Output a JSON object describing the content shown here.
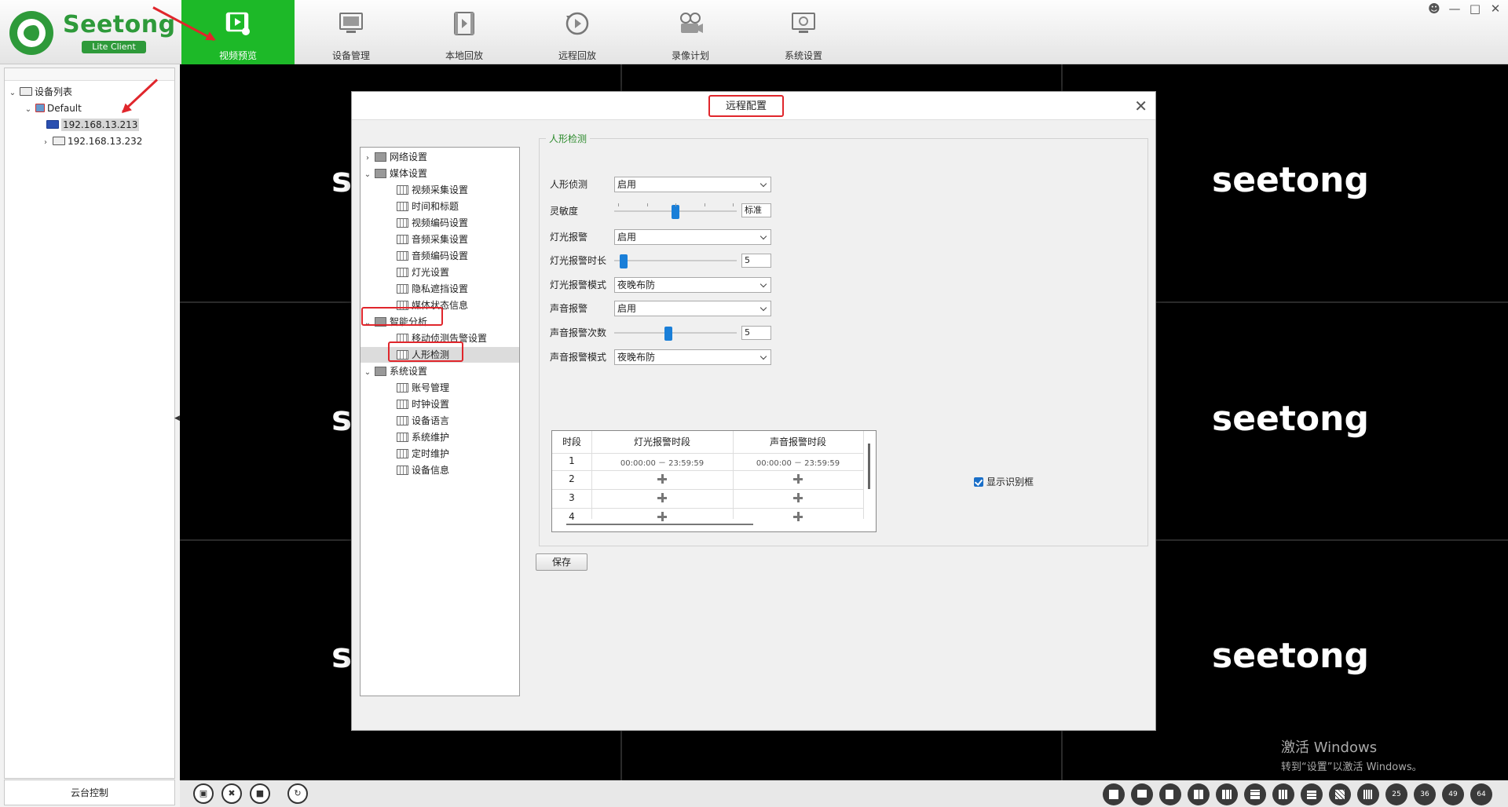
{
  "app": {
    "logo_name": "Seetong",
    "logo_sub": "Lite Client"
  },
  "nav": [
    {
      "label": "视频预览",
      "icon": "video-preview-icon",
      "active": true
    },
    {
      "label": "设备管理",
      "icon": "device-manage-icon",
      "active": false
    },
    {
      "label": "本地回放",
      "icon": "local-playback-icon",
      "active": false
    },
    {
      "label": "远程回放",
      "icon": "remote-playback-icon",
      "active": false
    },
    {
      "label": "录像计划",
      "icon": "record-plan-icon",
      "active": false
    },
    {
      "label": "系统设置",
      "icon": "system-settings-icon",
      "active": false
    }
  ],
  "sidebar": {
    "root": "设备列表",
    "group": "Default",
    "devices": [
      "192.168.13.213",
      "192.168.13.232"
    ],
    "ptz_tab": "云台控制"
  },
  "video": {
    "watermark": "seetong",
    "watermark_partial": "s"
  },
  "activation": {
    "line1": "激活 Windows",
    "line2": "转到“设置”以激活 Windows。"
  },
  "bottom": {
    "layout_labels": [
      "25",
      "36",
      "49",
      "64"
    ]
  },
  "dialog": {
    "title": "远程配置",
    "tree": [
      {
        "label": "网络设置",
        "level": 0,
        "expand": "›"
      },
      {
        "label": "媒体设置",
        "level": 0,
        "expand": "⌄"
      },
      {
        "label": "视频采集设置",
        "level": 1
      },
      {
        "label": "时间和标题",
        "level": 1
      },
      {
        "label": "视频编码设置",
        "level": 1
      },
      {
        "label": "音频采集设置",
        "level": 1
      },
      {
        "label": "音频编码设置",
        "level": 1
      },
      {
        "label": "灯光设置",
        "level": 1
      },
      {
        "label": "隐私遮挡设置",
        "level": 1
      },
      {
        "label": "媒体状态信息",
        "level": 1
      },
      {
        "label": "智能分析",
        "level": 0,
        "expand": "⌄"
      },
      {
        "label": "移动侦测告警设置",
        "level": 1
      },
      {
        "label": "人形检测",
        "level": 1,
        "selected": true
      },
      {
        "label": "系统设置",
        "level": 0,
        "expand": "⌄"
      },
      {
        "label": "账号管理",
        "level": 1
      },
      {
        "label": "时钟设置",
        "level": 1
      },
      {
        "label": "设备语言",
        "level": 1
      },
      {
        "label": "系统维护",
        "level": 1
      },
      {
        "label": "定时维护",
        "level": 1
      },
      {
        "label": "设备信息",
        "level": 1
      }
    ],
    "group_title": "人形检测",
    "fields": {
      "human_detect_label": "人形侦测",
      "human_detect_value": "启用",
      "sensitivity_label": "灵敏度",
      "sensitivity_value": "标准",
      "sensitivity_level": 0.5,
      "light_alarm_label": "灯光报警",
      "light_alarm_value": "启用",
      "light_duration_label": "灯光报警时长",
      "light_duration_value": "5",
      "light_duration_level": 0.05,
      "light_mode_label": "灯光报警模式",
      "light_mode_value": "夜晚布防",
      "sound_alarm_label": "声音报警",
      "sound_alarm_value": "启用",
      "sound_count_label": "声音报警次数",
      "sound_count_value": "5",
      "sound_count_level": 0.44,
      "sound_mode_label": "声音报警模式",
      "sound_mode_value": "夜晚布防"
    },
    "schedule": {
      "headers": [
        "时段",
        "灯光报警时段",
        "声音报警时段"
      ],
      "rows": [
        {
          "index": "1",
          "light": "00:00:00 － 23:59:59",
          "sound": "00:00:00 － 23:59:59"
        },
        {
          "index": "2",
          "light": "",
          "sound": ""
        },
        {
          "index": "3",
          "light": "",
          "sound": ""
        },
        {
          "index": "4",
          "light": "",
          "sound": ""
        }
      ]
    },
    "show_box_label": "显示识别框",
    "save_label": "保存"
  },
  "colors": {
    "brand_green": "#2e9a3a",
    "nav_active": "#1db928",
    "highlight_red": "#e0262c",
    "slider_blue": "#1a7fd8",
    "group_title_green": "#2b8a2b"
  }
}
